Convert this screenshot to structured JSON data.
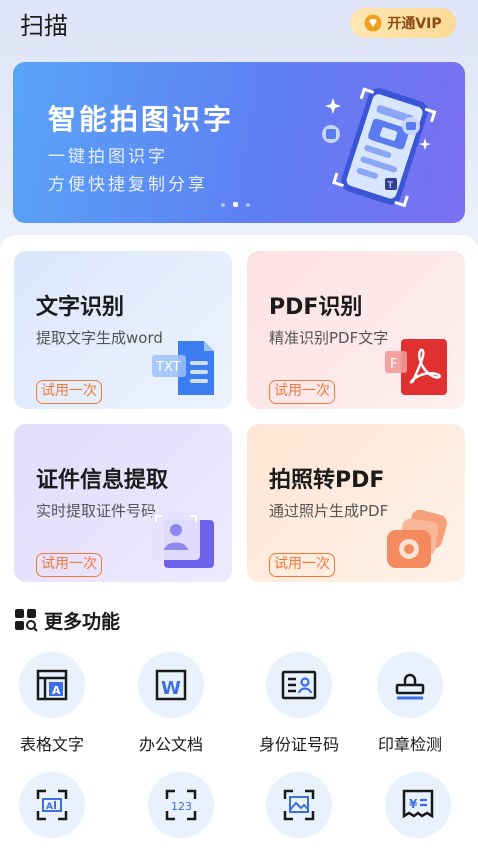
{
  "header": {
    "title": "扫描",
    "vip_label": "开通VIP"
  },
  "banner": {
    "title": "智能拍图识字",
    "sub1": "一键拍图识字",
    "sub2": "方便快捷复制分享"
  },
  "cards": [
    {
      "title": "文字识别",
      "sub": "提取文字生成word",
      "try": "试用一次"
    },
    {
      "title": "PDF识别",
      "sub": "精准识别PDF文字",
      "try": "试用一次"
    },
    {
      "title": "证件信息提取",
      "sub": "实时提取证件号码",
      "try": "试用一次"
    },
    {
      "title": "拍照转PDF",
      "sub": "通过照片生成PDF",
      "try": "试用一次"
    }
  ],
  "more": {
    "title": "更多功能",
    "items": [
      {
        "label": "表格文字",
        "icon": "table-icon"
      },
      {
        "label": "办公文档",
        "icon": "word-icon"
      },
      {
        "label": "身份证号码",
        "icon": "id-card-icon"
      },
      {
        "label": "印章检测",
        "icon": "stamp-icon"
      },
      {
        "label": "",
        "icon": "scan-text-icon"
      },
      {
        "label": "",
        "icon": "number-scan-icon"
      },
      {
        "label": "",
        "icon": "image-scan-icon"
      },
      {
        "label": "",
        "icon": "receipt-icon"
      }
    ]
  },
  "colors": {
    "accent": "#3c6fe4",
    "try_border": "#f27a3b",
    "vip_bg": "#fbd995"
  }
}
